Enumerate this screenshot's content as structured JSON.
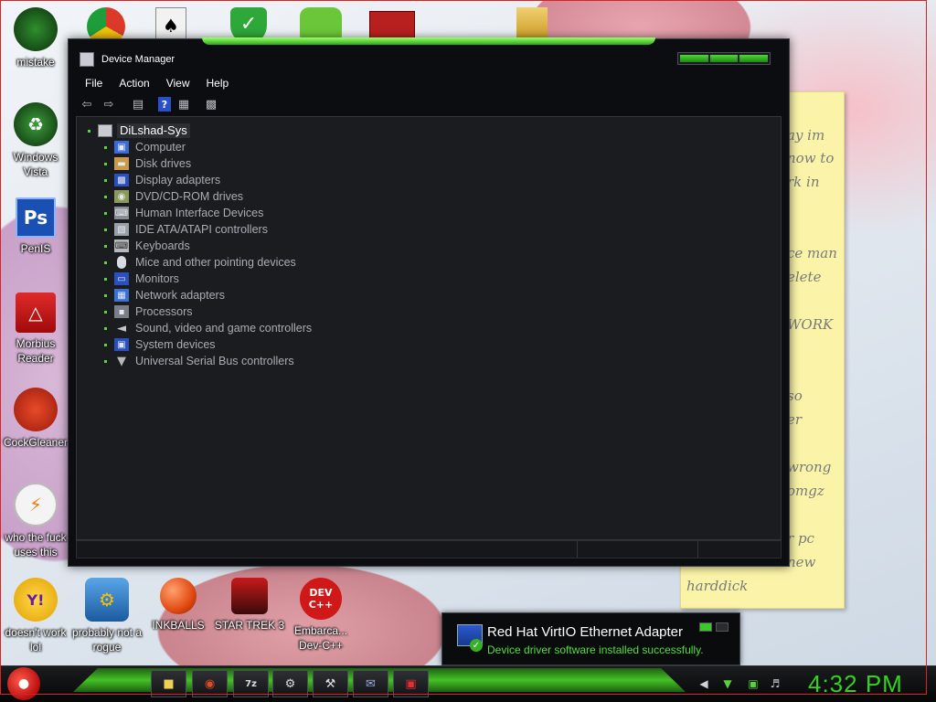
{
  "desktop": {
    "icons": [
      {
        "label": "mistake",
        "icon": "razer-icon"
      },
      {
        "label": "Windows Vista",
        "icon": "recycle-bin-icon"
      },
      {
        "label": "PenIS",
        "icon": "photoshop-icon",
        "glyph": "Ps"
      },
      {
        "label": "Morbius Reader",
        "icon": "pdf-reader-icon"
      },
      {
        "label": "CockGleaner",
        "icon": "ccleaner-icon"
      },
      {
        "label": "who the fuck uses this",
        "icon": "lightning-icon"
      },
      {
        "label": "doesn't work lol",
        "icon": "yahoo-messenger-icon",
        "glyph": "Y!"
      },
      {
        "label": "probably not a rogue",
        "icon": "gears-icon"
      },
      {
        "label": "INKBALLS",
        "icon": "inkball-icon"
      },
      {
        "label": "STAR TREK 3",
        "icon": "star-wars-game-icon"
      },
      {
        "label": "Embarca... Dev-C++",
        "icon": "devcpp-icon",
        "glyph": "DEV C++"
      }
    ],
    "top_icons": [
      "chrome-icon",
      "solitaire-icon",
      "security-shield-icon",
      "angry-birds-pig-icon",
      "mail-icon",
      "folder-icon"
    ]
  },
  "sticky_note": {
    "lines": [
      "ay im",
      "now to",
      "rk in",
      "ce man",
      "elete",
      "WORK",
      "so",
      "er",
      "wrong",
      "omgz",
      "r pc",
      "new",
      "harddick"
    ]
  },
  "device_manager": {
    "title": "Device Manager",
    "menu": [
      "File",
      "Action",
      "View",
      "Help"
    ],
    "toolbar": [
      "back-icon",
      "forward-icon",
      "properties-icon",
      "help-icon",
      "view-icon",
      "scan-hardware-icon"
    ],
    "root": "DiLshad-Sys",
    "items": [
      {
        "label": "Computer",
        "icon": "computer-icon"
      },
      {
        "label": "Disk drives",
        "icon": "disk-drive-icon"
      },
      {
        "label": "Display adapters",
        "icon": "display-adapter-icon"
      },
      {
        "label": "DVD/CD-ROM drives",
        "icon": "dvd-drive-icon"
      },
      {
        "label": "Human Interface Devices",
        "icon": "hid-icon"
      },
      {
        "label": "IDE ATA/ATAPI controllers",
        "icon": "ide-controller-icon"
      },
      {
        "label": "Keyboards",
        "icon": "keyboard-icon"
      },
      {
        "label": "Mice and other pointing devices",
        "icon": "mouse-icon"
      },
      {
        "label": "Monitors",
        "icon": "monitor-icon"
      },
      {
        "label": "Network adapters",
        "icon": "network-adapter-icon"
      },
      {
        "label": "Processors",
        "icon": "processor-icon"
      },
      {
        "label": "Sound, video and game controllers",
        "icon": "speaker-icon"
      },
      {
        "label": "System devices",
        "icon": "system-devices-icon"
      },
      {
        "label": "Universal Serial Bus controllers",
        "icon": "usb-icon"
      }
    ]
  },
  "notification": {
    "title": "Red Hat VirtIO Ethernet Adapter",
    "message": "Device driver software installed successfully.",
    "icon": "network-adapter-check-icon"
  },
  "taskbar": {
    "pinned": [
      "explorer-icon",
      "chrome-icon",
      "7zip-icon",
      "media-icon",
      "tools-icon",
      "mail-icon",
      "cleaner-icon"
    ],
    "tray": [
      "back-arrow-icon",
      "device-install-icon",
      "network-icon",
      "volume-icon"
    ],
    "clock": "4:32 PM"
  },
  "colors": {
    "accent_green": "#35d11f",
    "window_bg": "#0c0d10",
    "panel_bg": "#1b1c20",
    "sticky_yellow": "#fbf4a8"
  }
}
